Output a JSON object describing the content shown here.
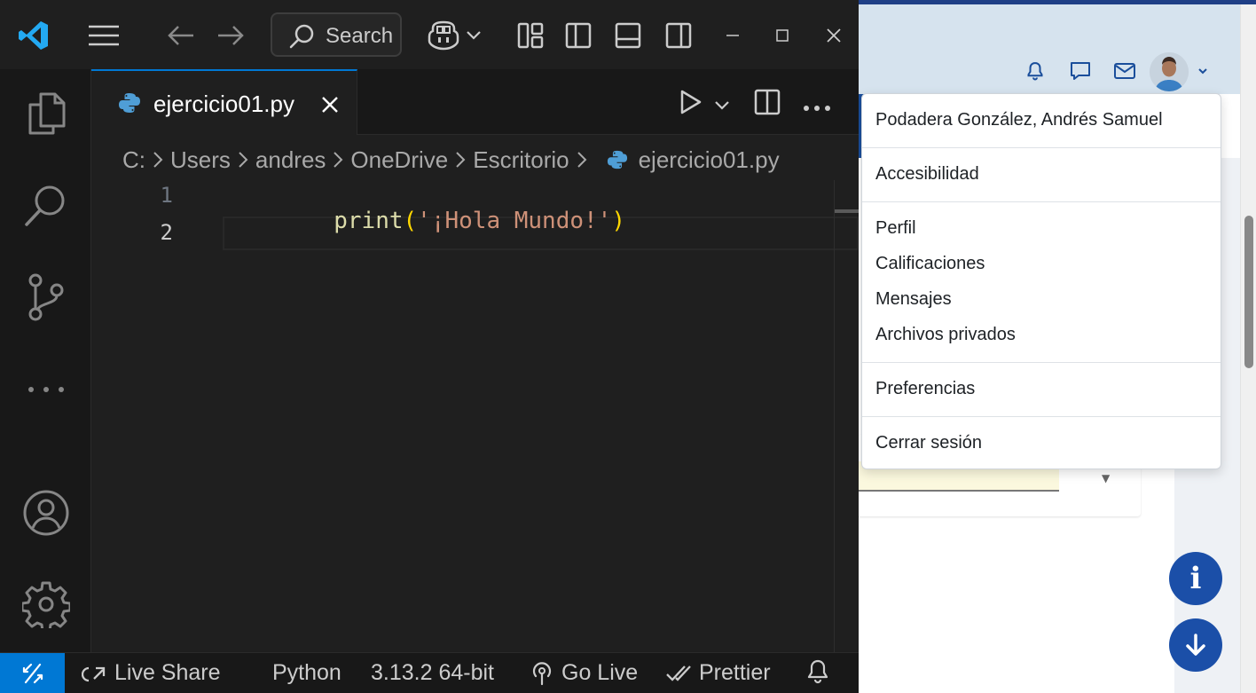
{
  "vscode": {
    "titlebar": {
      "search_label": "Search"
    },
    "tab": {
      "filename": "ejercicio01.py"
    },
    "breadcrumb": [
      "C:",
      "Users",
      "andres",
      "OneDrive",
      "Escritorio",
      "ejercicio01.py"
    ],
    "code": {
      "line_numbers": [
        "1",
        "2"
      ],
      "line1": {
        "func": "print",
        "open_paren": "(",
        "string": "'¡Hola Mundo!'",
        "close_paren": ")"
      }
    },
    "statusbar": {
      "live_share": "Live Share",
      "language": "Python",
      "interpreter": "3.13.2 64-bit",
      "go_live": "Go Live",
      "prettier": "Prettier"
    },
    "colors": {
      "accent": "#0078d4",
      "keyword_func": "#dcdcaa",
      "bracket": "#ffd700",
      "string": "#ce9178"
    }
  },
  "browser": {
    "user_menu": {
      "user_name": "Podadera González, Andrés Samuel",
      "items_group1": [
        "Accesibilidad"
      ],
      "items_group2": [
        "Perfil",
        "Calificaciones",
        "Mensajes",
        "Archivos privados"
      ],
      "items_group3": [
        "Preferencias"
      ],
      "items_group4": [
        "Cerrar sesión"
      ]
    },
    "header_icons": [
      "bell-icon",
      "chat-icon",
      "mail-icon"
    ],
    "fab_info_label": "i",
    "colors": {
      "brand_blue": "#1a4e9b",
      "fab": "#1b4fa8"
    }
  }
}
